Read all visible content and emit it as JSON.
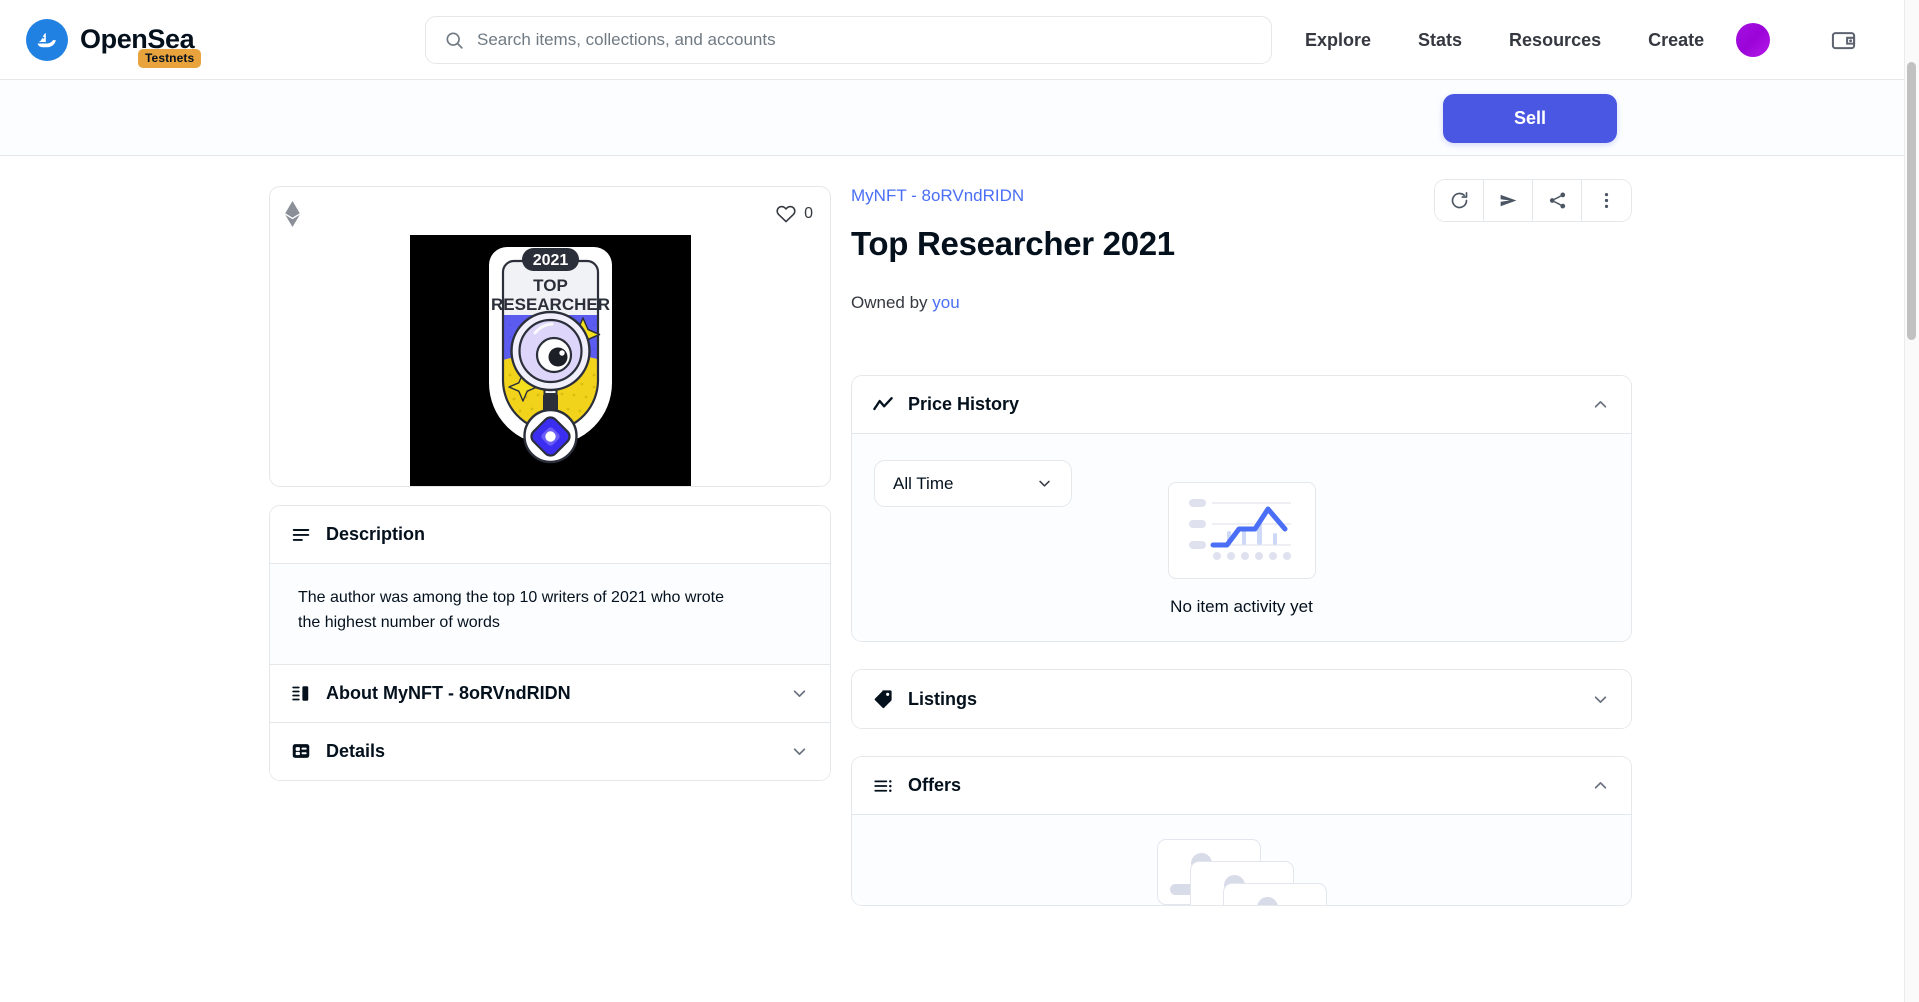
{
  "nav": {
    "brand_name": "OpenSea",
    "brand_badge": "Testnets",
    "logo_icon": "opensea-sailboat-icon",
    "search": {
      "placeholder": "Search items, collections, and accounts",
      "value": "",
      "icon": "search-icon"
    },
    "links": [
      {
        "label": "Explore"
      },
      {
        "label": "Stats"
      },
      {
        "label": "Resources"
      },
      {
        "label": "Create"
      }
    ],
    "avatar_icon": "user-avatar",
    "wallet_icon": "wallet-icon"
  },
  "actionbar": {
    "sell_label": "Sell"
  },
  "media": {
    "chain_icon": "ethereum-icon",
    "favorite_icon": "heart-icon",
    "favorite_count": "0",
    "artwork": {
      "year": "2021",
      "line1": "TOP",
      "line2": "RESEARCHER"
    }
  },
  "item": {
    "collection": "MyNFT - 8oRVndRIDN",
    "title": "Top Researcher 2021",
    "owned_prefix": "Owned by",
    "owned_by": "you",
    "actions": [
      {
        "name": "refresh-icon",
        "title": "Refresh metadata"
      },
      {
        "name": "send-icon",
        "title": "Transfer"
      },
      {
        "name": "share-icon",
        "title": "Share"
      },
      {
        "name": "more-options-icon",
        "title": "More"
      }
    ]
  },
  "description": {
    "icon": "description-lines-icon",
    "title": "Description",
    "body": "The author was among the top 10 writers of 2021 who wrote the highest number of words"
  },
  "about": {
    "icon": "about-bars-icon",
    "title": "About MyNFT - 8oRVndRIDN",
    "chevron": "chevron-down-icon",
    "expanded": false
  },
  "details": {
    "icon": "details-grid-icon",
    "title": "Details",
    "chevron": "chevron-down-icon",
    "expanded": false
  },
  "price_history": {
    "icon": "trending-chart-icon",
    "title": "Price History",
    "chevron": "chevron-up-icon",
    "expanded": true,
    "range_selected": "All Time",
    "range_chevron": "chevron-down-icon",
    "empty_text": "No item activity yet",
    "empty_illustration": "line-chart-placeholder"
  },
  "listings": {
    "icon": "tag-icon",
    "title": "Listings",
    "chevron": "chevron-down-icon",
    "expanded": false
  },
  "offers": {
    "icon": "list-icon",
    "title": "Offers",
    "chevron": "chevron-up-icon",
    "expanded": true,
    "empty_illustration": "stacked-cards-placeholder"
  },
  "colors": {
    "accent_blue": "#4a57e3",
    "link_blue": "#4a6ef5",
    "brand_blue": "#2081e2",
    "badge_orange": "#e8a33d",
    "avatar_purple": "#a510e0",
    "text_dark": "#04111d",
    "border": "#e5e8eb",
    "panel_bg": "#fbfdff"
  }
}
